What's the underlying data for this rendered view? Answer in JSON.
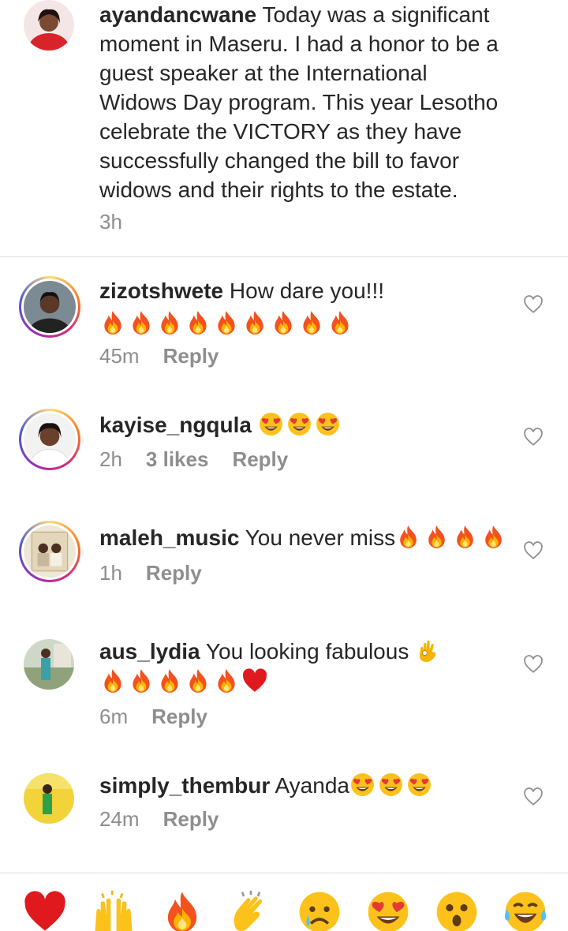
{
  "caption": {
    "username": "ayandancwane",
    "text": "Today was a significant moment in Maseru. I had a honor to be a guest speaker at the International Widows Day program. This year Lesotho celebrate the VICTORY as they have successfully changed the bill to favor widows and their rights to the estate.",
    "time": "3h"
  },
  "comments": [
    {
      "username": "zizotshwete",
      "text": "How dare you!!!",
      "emojis": [
        "fire",
        "fire",
        "fire",
        "fire",
        "fire",
        "fire",
        "fire",
        "fire",
        "fire"
      ],
      "time": "45m",
      "likes": "",
      "reply": "Reply"
    },
    {
      "username": "kayise_ngqula",
      "text": "",
      "emojis": [
        "heart-eyes",
        "heart-eyes",
        "heart-eyes"
      ],
      "time": "2h",
      "likes": "3 likes",
      "reply": "Reply"
    },
    {
      "username": "maleh_music",
      "text": "You never miss",
      "emojis": [
        "fire",
        "fire",
        "fire",
        "fire"
      ],
      "time": "1h",
      "likes": "",
      "reply": "Reply"
    },
    {
      "username": "aus_lydia",
      "text": "You looking  fabulous",
      "emojis": [
        "ok-hand",
        "fire",
        "fire",
        "fire",
        "fire",
        "fire",
        "red-heart"
      ],
      "time": "6m",
      "likes": "",
      "reply": "Reply"
    },
    {
      "username": "simply_thembur",
      "text": "Ayanda",
      "emojis": [
        "heart-eyes",
        "heart-eyes",
        "heart-eyes"
      ],
      "time": "24m",
      "likes": "",
      "reply": "Reply"
    }
  ],
  "reactions": [
    "red-heart",
    "raising-hands",
    "fire",
    "clapping-hands",
    "sad-face",
    "heart-eyes",
    "surprised-face",
    "tears-of-joy"
  ],
  "colors": {
    "text": "#262626",
    "secondary": "#8e8e8e",
    "divider": "#dbdbdb"
  }
}
